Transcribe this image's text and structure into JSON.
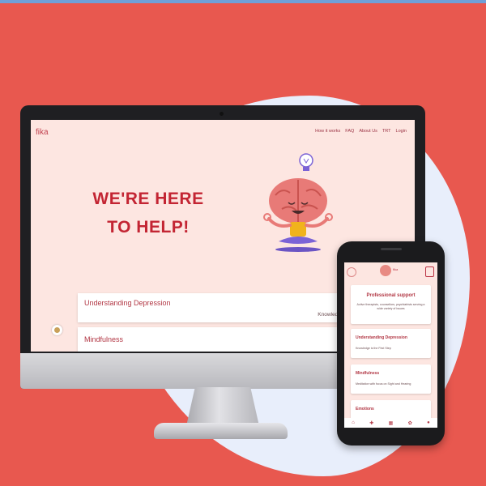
{
  "colors": {
    "background": "#e8584f",
    "blob": "#e8eefb",
    "screen_bg": "#fde6e1",
    "accent": "#c32533"
  },
  "desktop": {
    "logo": "fika",
    "nav": [
      "How it works",
      "FAQ",
      "About Us",
      "TRT",
      "Login"
    ],
    "hero_title": "WE'RE HERE TO HELP!",
    "cards": [
      {
        "title": "Understanding Depression",
        "subtitle": "Knowledge is fi"
      },
      {
        "title": "Mindfulness",
        "subtitle": ""
      }
    ]
  },
  "mobile": {
    "logo_text": "fika",
    "cards": [
      {
        "title": "Professional support",
        "subtitle": "Active therapists, counsellors, psychiatrists serving a wide variety of issues"
      },
      {
        "title": "Understanding Depression",
        "subtitle": "Knowledge is the First Step"
      },
      {
        "title": "Mindfulness",
        "subtitle": "Meditation with focus on Sight and Hearing"
      },
      {
        "title": "Emotions",
        "subtitle": ""
      }
    ],
    "nav_icons": [
      "home-icon",
      "puzzle-icon",
      "grid-icon",
      "yoga-icon",
      "profile-icon"
    ]
  }
}
